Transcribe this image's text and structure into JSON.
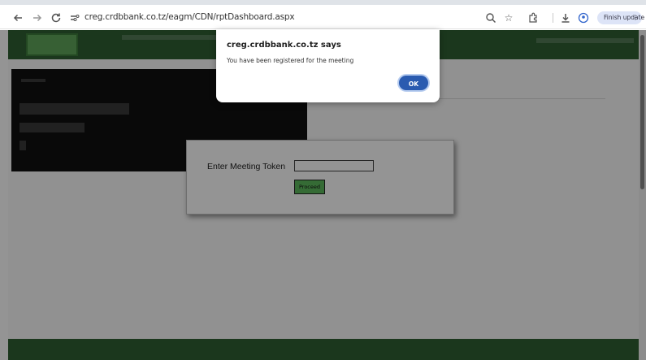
{
  "browser": {
    "url": "creg.crdbbank.co.tz/eagm/CDN/rptDashboard.aspx",
    "finish_update_label": "Finish update",
    "menu_glyph": "⋮",
    "icons": [
      "back-icon",
      "forward-icon",
      "reload-icon",
      "site-settings-icon",
      "zoom-icon",
      "bookmark-star-icon",
      "extensions-icon",
      "download-icon",
      "profile-icon"
    ]
  },
  "page": {
    "token_label": "Enter Meeting Token",
    "token_value": "",
    "proceed_label": "Proceed",
    "colors": {
      "header_green": "#2f5f33",
      "button_green": "#5cb85c"
    }
  },
  "alert": {
    "title": "creg.crdbbank.co.tz says",
    "message": "You have been registered for the meeting",
    "ok_label": "OK",
    "accent": "#2a5bb0"
  }
}
